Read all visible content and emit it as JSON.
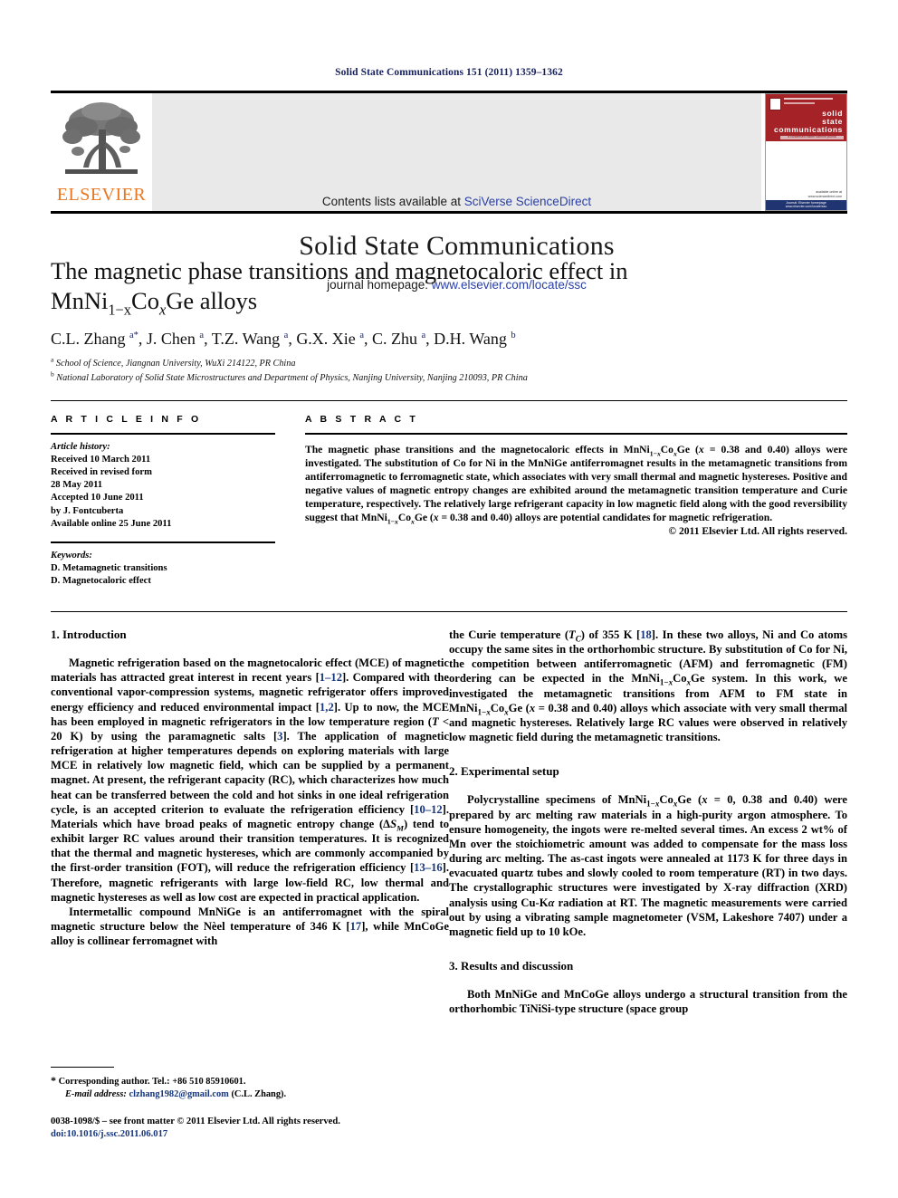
{
  "running_head": "Solid State Communications 151 (2011) 1359–1362",
  "masthead": {
    "contents_prefix": "Contents lists available at ",
    "contents_link": "SciVerse ScienceDirect",
    "journal_title": "Solid State Communications",
    "homepage_prefix": "journal homepage: ",
    "homepage_link": "www.elsevier.com/locate/ssc",
    "publisher_logo_text": "ELSEVIER",
    "cover": {
      "line1": "solid",
      "line2": "state",
      "line3": "communications",
      "tagline": "a condensed matter science journal",
      "footer1": "available online at",
      "footer2": "www.sciencedirect.com",
      "bottom_band": "Journal: Elsevier homepage www.elsevier.com/locate/ssc"
    }
  },
  "title": {
    "line1": "The magnetic phase transitions and magnetocaloric effect in",
    "formula_prefix": "MnNi",
    "sub1": "1−x",
    "mid": "Co",
    "sub2": "x",
    "suffix": "Ge alloys"
  },
  "authors": {
    "list": "C.L. Zhang a*, J. Chen a, T.Z. Wang a, G.X. Xie a, C. Zhu a, D.H. Wang b",
    "affil_a_marker": "a",
    "affil_a": "School of Science, Jiangnan University, WuXi 214122, PR China",
    "affil_b_marker": "b",
    "affil_b": "National Laboratory of Solid State Microstructures and Department of Physics, Nanjing University, Nanjing 210093, PR China"
  },
  "article_info": {
    "heading": "A R T I C L E   I N F O",
    "history_label": "Article history:",
    "history": [
      "Received 10 March 2011",
      "Received in revised form",
      "28 May 2011",
      "Accepted 10 June 2011",
      "by J. Fontcuberta",
      "Available online 25 June 2011"
    ],
    "keywords_label": "Keywords:",
    "keywords": [
      "D. Metamagnetic transitions",
      "D. Magnetocaloric effect"
    ]
  },
  "abstract": {
    "heading": "A B S T R A C T",
    "copyright": "© 2011 Elsevier Ltd. All rights reserved."
  },
  "sections": {
    "intro_heading": "1. Introduction",
    "experimental_heading": "2. Experimental setup",
    "results_heading": "3. Results and discussion"
  },
  "footnote": {
    "star": "*",
    "corresponding": "Corresponding author. Tel.: +86 510 85910601.",
    "email_label": "E-mail address:",
    "email": "clzhang1982@gmail.com",
    "email_suffix": "(C.L. Zhang)."
  },
  "colophon": {
    "line1": "0038-1098/$ – see front matter © 2011 Elsevier Ltd. All rights reserved.",
    "doi": "doi:10.1016/j.ssc.2011.06.017"
  },
  "colors": {
    "running_head": "#16205c",
    "link": "#2a40a8",
    "reference": "#16357a",
    "elsevier_orange": "#e87722",
    "cover_red": "#a52226",
    "cover_blue": "#1f3470"
  }
}
